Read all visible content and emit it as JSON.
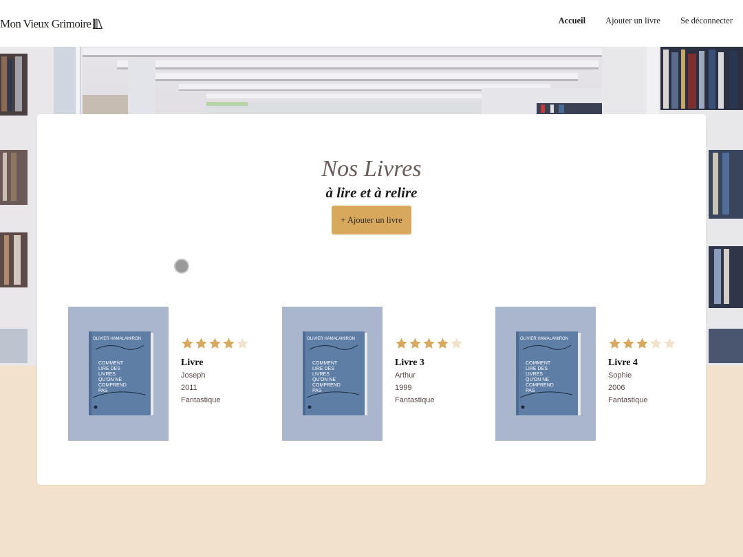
{
  "header": {
    "logo_text": "Mon Vieux Grimoire",
    "nav": {
      "home": "Accueil",
      "add_book": "Ajouter un livre",
      "logout": "Se déconnecter"
    }
  },
  "main": {
    "title": "Nos Livres",
    "subtitle": "à lire et à relire",
    "add_button_label": "+ Ajouter un livre"
  },
  "books": [
    {
      "title": "Livre",
      "author": "Joseph",
      "year": "2011",
      "genre": "Fantastique",
      "rating": 4
    },
    {
      "title": "Livre 3",
      "author": "Arthur",
      "year": "1999",
      "genre": "Fantastique",
      "rating": 4
    },
    {
      "title": "Livre 4",
      "author": "Sophie",
      "year": "2006",
      "genre": "Fantastique",
      "rating": 3
    }
  ],
  "cover": {
    "author_text": "OLIVIER HAMALAMIRON",
    "title_lines": [
      "COMMENT",
      "LIRE DES",
      "LIVRES",
      "QU'ON NE",
      "COMPREND",
      "PAS"
    ]
  },
  "colors": {
    "accent": "#d8a95c",
    "star_filled": "#d8a95c",
    "star_empty": "#f2e2cc",
    "page_bg": "#f2e2cc",
    "cover_bg": "#aab6cc",
    "book_blue": "#5f7ea6"
  },
  "icons": {
    "logo_mark": "books-icon",
    "star": "star-icon",
    "loading": "spinner-icon"
  }
}
